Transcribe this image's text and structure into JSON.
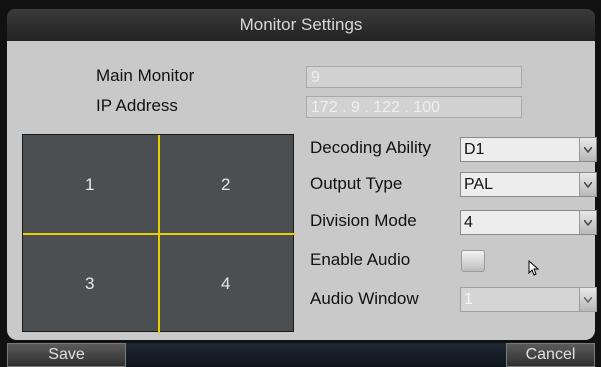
{
  "window": {
    "title": "Monitor Settings"
  },
  "main_monitor": {
    "label": "Main Monitor",
    "value": "9"
  },
  "ip_address": {
    "label": "IP Address",
    "value": "172 . 9    . 122 . 100"
  },
  "division_preview": {
    "cells": [
      "1",
      "2",
      "3",
      "4"
    ],
    "divider_color": "#e6d000"
  },
  "decoding_ability": {
    "label": "Decoding Ability",
    "value": "D1"
  },
  "output_type": {
    "label": "Output Type",
    "value": "PAL"
  },
  "division_mode": {
    "label": "Division Mode",
    "value": "4"
  },
  "enable_audio": {
    "label": "Enable Audio",
    "checked": false
  },
  "audio_window": {
    "label": "Audio Window",
    "value": "1",
    "disabled": true
  },
  "buttons": {
    "save": "Save",
    "cancel": "Cancel"
  }
}
